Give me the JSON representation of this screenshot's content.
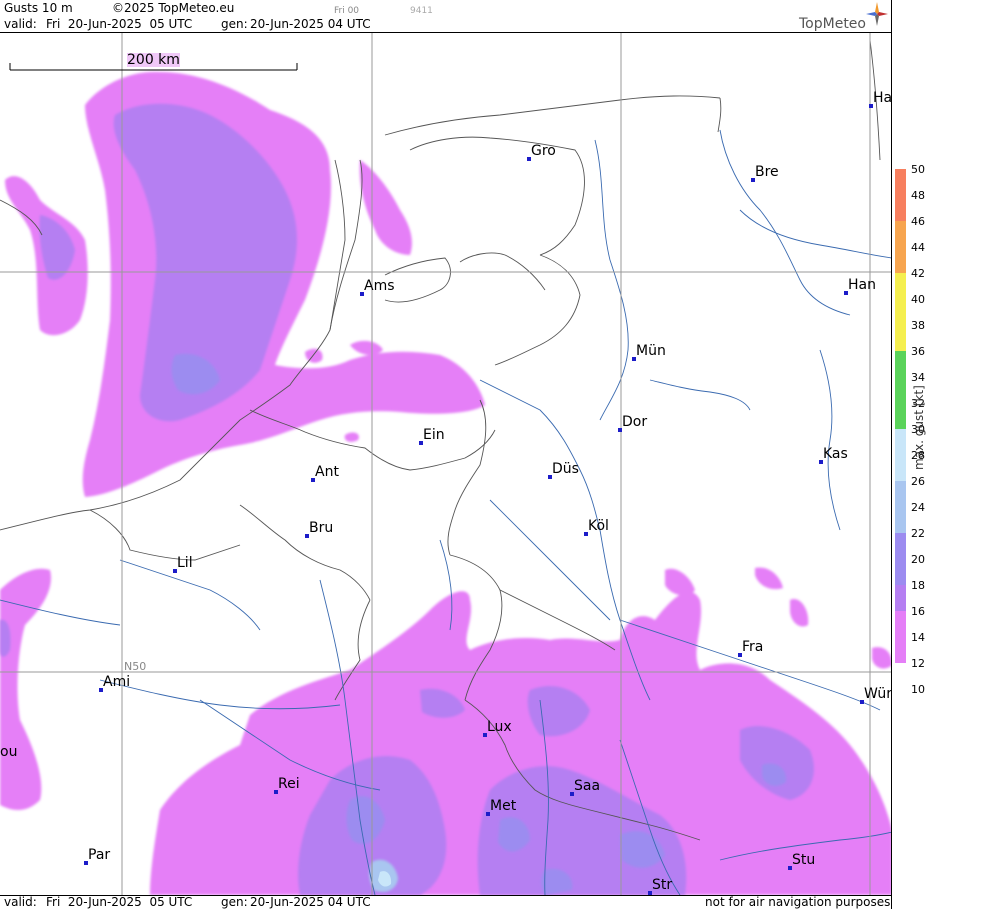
{
  "header": {
    "product": "Gusts 10 m",
    "copyright": "©2025 TopMeteo.eu",
    "run_tag": "Fri 00",
    "code": "9411",
    "valid_label": "valid:",
    "valid_value": "Fri  20-Jun-2025  05 UTC",
    "gen_label": "gen:",
    "gen_value": "20-Jun-2025 04 UTC",
    "brand": "TopMeteo"
  },
  "map": {
    "scale_label": "200 km",
    "lat_label": "N50",
    "cities": [
      {
        "id": "ham",
        "label": "Ha"
      },
      {
        "id": "gro",
        "label": "Gro"
      },
      {
        "id": "bre",
        "label": "Bre"
      },
      {
        "id": "ams",
        "label": "Ams"
      },
      {
        "id": "han",
        "label": "Han"
      },
      {
        "id": "mun",
        "label": "Mün"
      },
      {
        "id": "dor",
        "label": "Dor"
      },
      {
        "id": "ein",
        "label": "Ein"
      },
      {
        "id": "kas",
        "label": "Kas"
      },
      {
        "id": "dus",
        "label": "Düs"
      },
      {
        "id": "ant",
        "label": "Ant"
      },
      {
        "id": "kol",
        "label": "Köl"
      },
      {
        "id": "bru",
        "label": "Bru"
      },
      {
        "id": "lil",
        "label": "Lil"
      },
      {
        "id": "fra",
        "label": "Fra"
      },
      {
        "id": "ami",
        "label": "Ami"
      },
      {
        "id": "wur",
        "label": "Wür"
      },
      {
        "id": "lux",
        "label": "Lux"
      },
      {
        "id": "rou",
        "label": "ou"
      },
      {
        "id": "rei",
        "label": "Rei"
      },
      {
        "id": "saa",
        "label": "Saa"
      },
      {
        "id": "met",
        "label": "Met"
      },
      {
        "id": "par",
        "label": "Par"
      },
      {
        "id": "stu",
        "label": "Stu"
      },
      {
        "id": "str",
        "label": "Str"
      }
    ]
  },
  "legend": {
    "title": "max. gust [kt]",
    "ticks": [
      "50",
      "48",
      "46",
      "44",
      "42",
      "40",
      "38",
      "36",
      "34",
      "32",
      "30",
      "28",
      "26",
      "24",
      "22",
      "20",
      "18",
      "16",
      "14",
      "12",
      "10"
    ],
    "colors": {
      "light_magenta": "#e57ff7",
      "violet": "#b57ff2",
      "blue_violet": "#9c8cf0",
      "light_blue": "#a9c6f0",
      "pale_blue": "#c9e6f9",
      "green": "#5ad35a",
      "yellow": "#f5ef4f",
      "orange": "#f7a54f",
      "red_orange": "#f77f5f"
    }
  },
  "footer": {
    "valid_label": "valid:",
    "valid_value": "Fri  20-Jun-2025  05 UTC",
    "gen_label": "gen:",
    "gen_value": "20-Jun-2025 04 UTC",
    "disclaimer": "not for air navigation purposes"
  }
}
